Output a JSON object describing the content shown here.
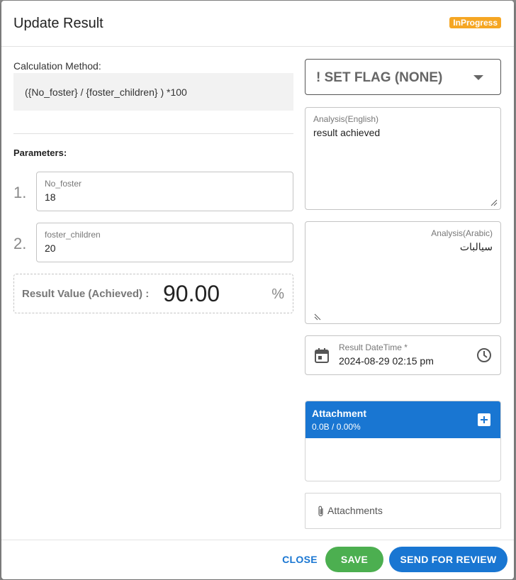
{
  "dialog": {
    "title": "Update Result",
    "status_badge": "InProgress"
  },
  "calculation": {
    "label": "Calculation Method:",
    "formula": "({No_foster} / {foster_children} ) *100"
  },
  "parameters": {
    "label": "Parameters:",
    "items": [
      {
        "index": "1.",
        "name": "No_foster",
        "value": "18"
      },
      {
        "index": "2.",
        "name": "foster_children",
        "value": "20"
      }
    ]
  },
  "result": {
    "label": "Result Value (Achieved) :",
    "value": "90.00",
    "unit": "%"
  },
  "flag": {
    "label": "! SET FLAG (NONE)"
  },
  "analysis_english": {
    "label": "Analysis(English)",
    "value": "result achieved"
  },
  "analysis_arabic": {
    "label": "Analysis(Arabic)",
    "value": "سيالبات"
  },
  "result_datetime": {
    "label": "Result DateTime *",
    "value": "2024-08-29 02:15 pm"
  },
  "attachment": {
    "title": "Attachment",
    "size": "0.0B / 0.00%",
    "link_label": "Attachments"
  },
  "footer": {
    "close_label": "CLOSE",
    "save_label": "SAVE",
    "send_label": "SEND FOR REVIEW"
  },
  "colors": {
    "primary": "#1976d2",
    "save": "#4caf50",
    "badge": "#f5a623"
  }
}
